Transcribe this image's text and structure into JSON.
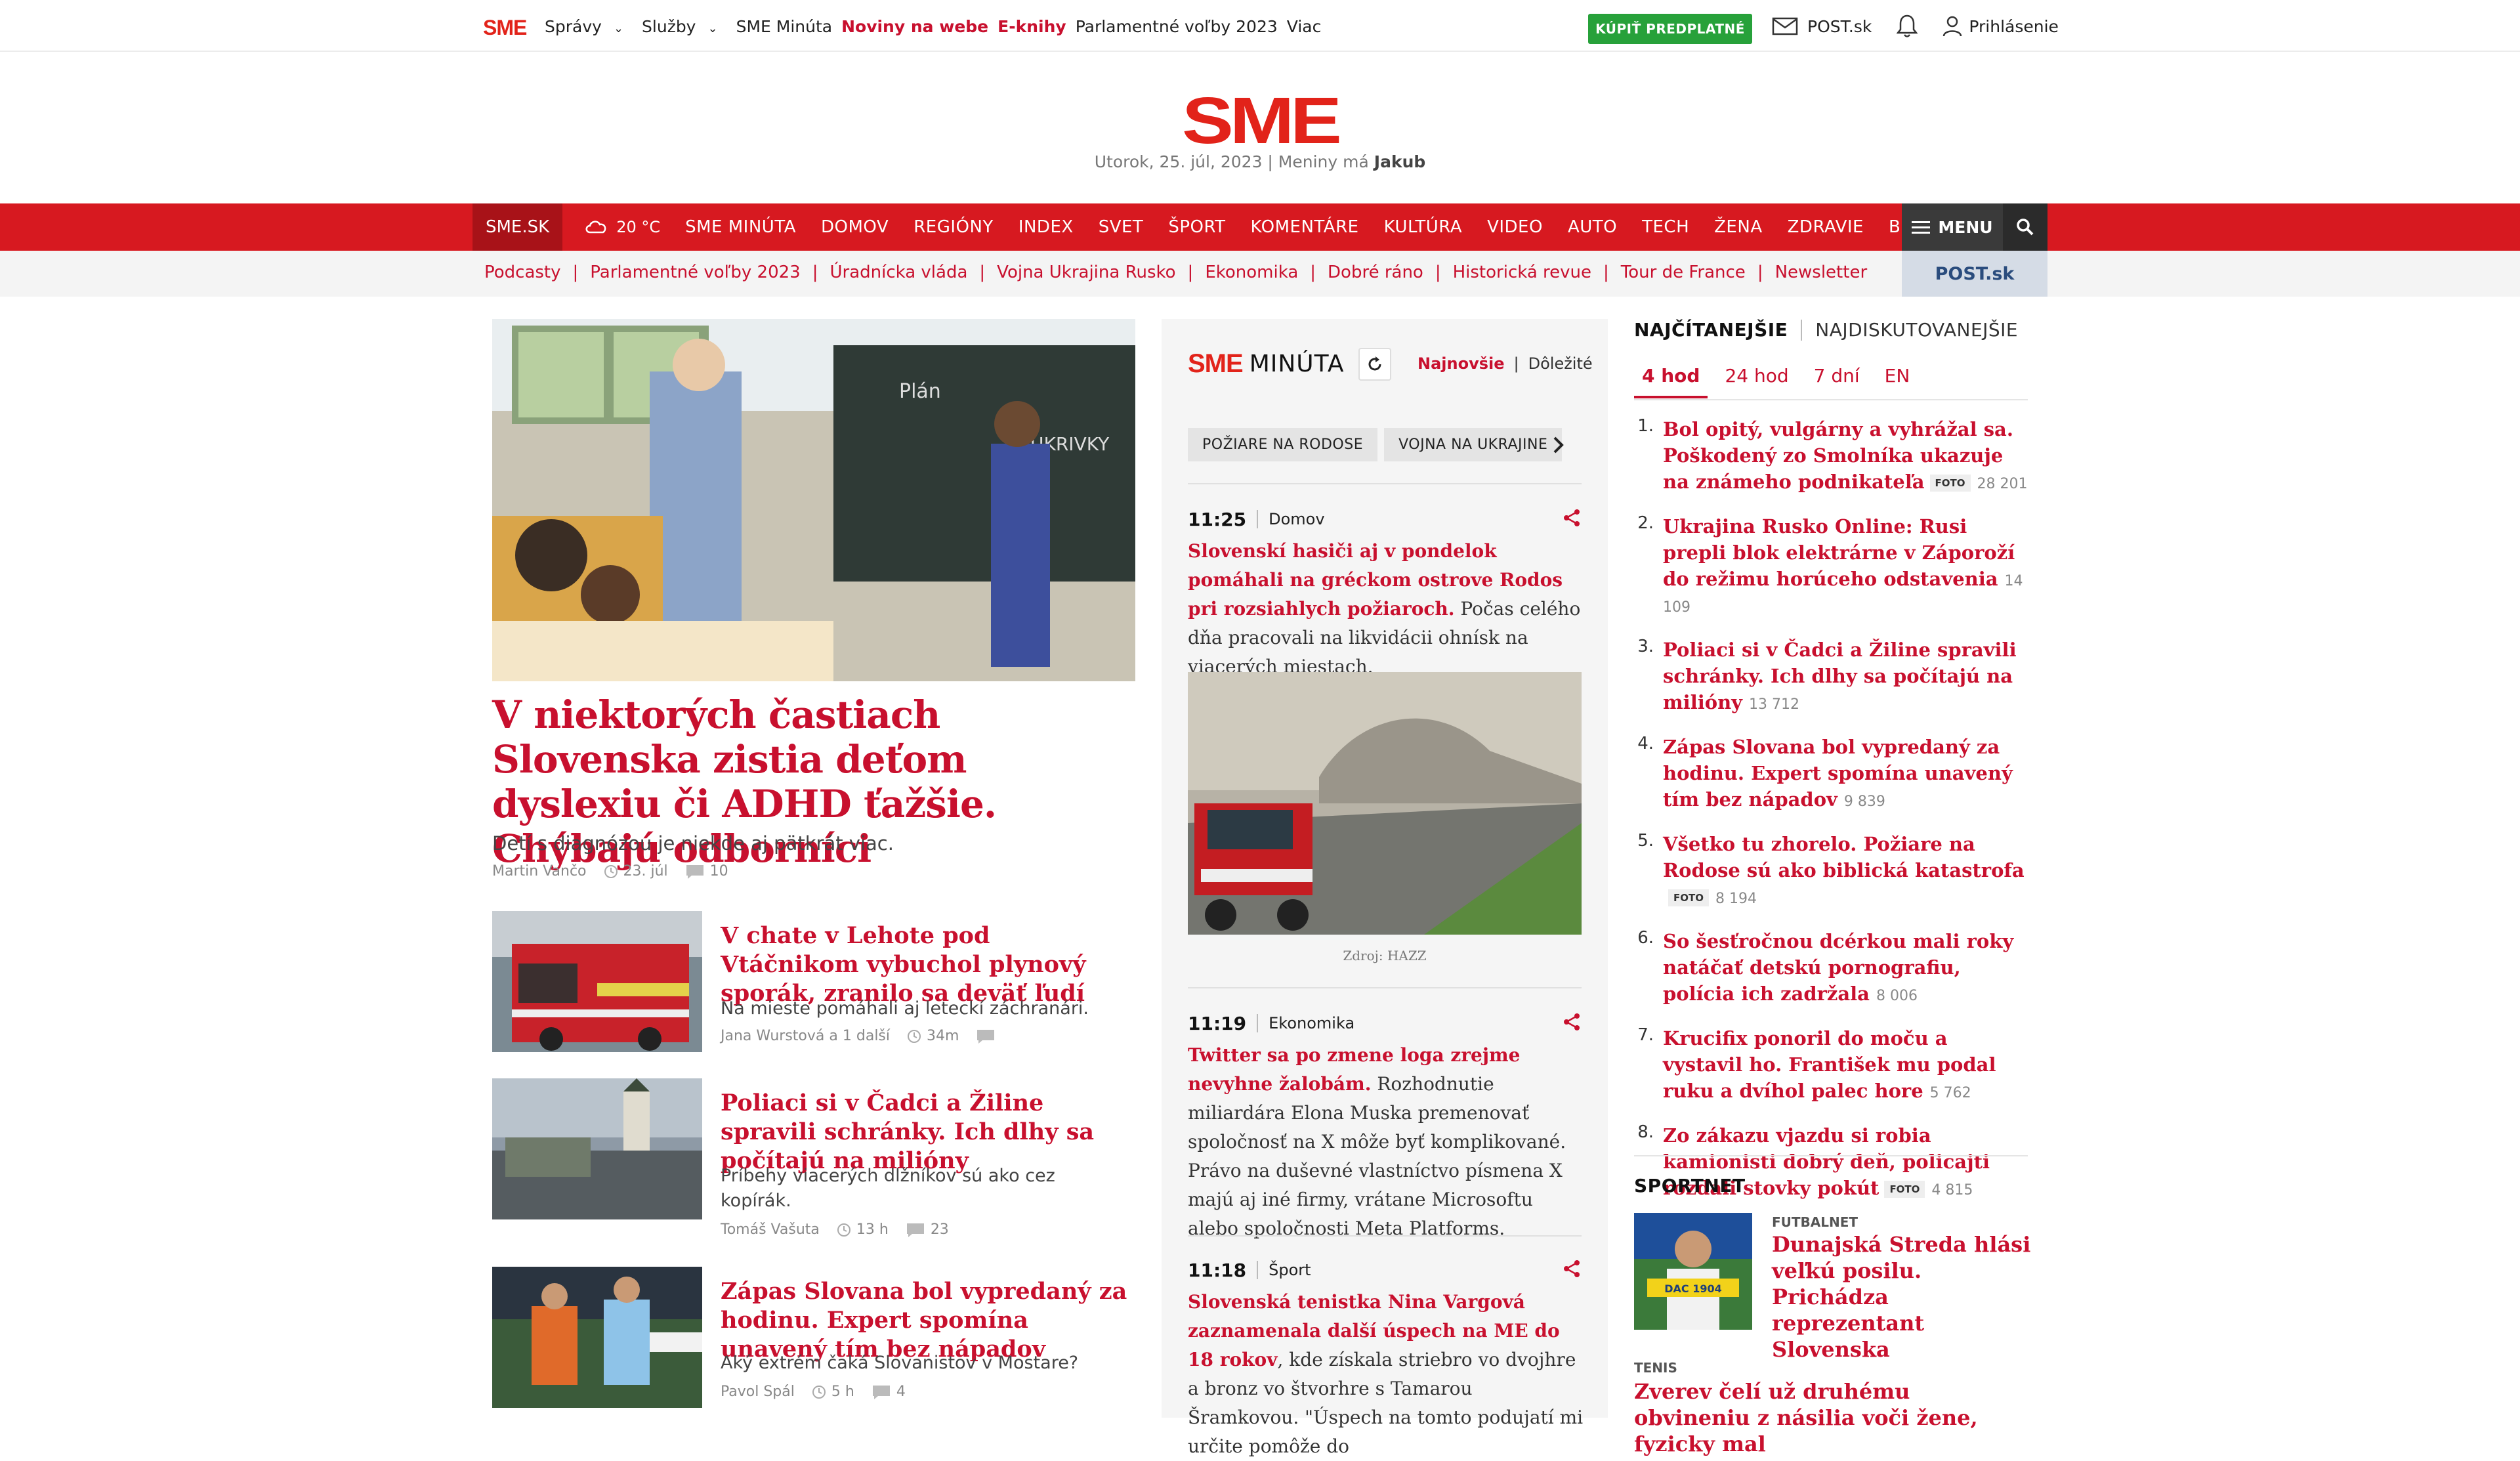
{
  "topbar": {
    "logo": "SME",
    "nav": [
      {
        "label": "Správy",
        "dropdown": true
      },
      {
        "label": "Služby",
        "dropdown": true
      },
      {
        "label": "SME Minúta"
      },
      {
        "label": "Noviny na webe",
        "highlight": true
      },
      {
        "label": "E-knihy",
        "highlight": true
      },
      {
        "label": "Parlamentné voľby 2023"
      },
      {
        "label": "Viac"
      }
    ],
    "subscribe": "KÚPIŤ PREDPLATNÉ",
    "post": "POST.sk",
    "login": "Prihlásenie"
  },
  "masthead": {
    "logo": "SME",
    "date": "Utorok, 25. júl, 2023 | Meniny má",
    "nameday": "Jakub"
  },
  "rednav": {
    "home": "SME.SK",
    "weather": "20 °C",
    "items": [
      "SME MINÚTA",
      "DOMOV",
      "REGIÓNY",
      "INDEX",
      "SVET",
      "ŠPORT",
      "KOMENTÁRE",
      "KULTÚRA",
      "VIDEO",
      "AUTO",
      "TECH",
      "ŽENA",
      "ZDRAVIE",
      "BLOG"
    ],
    "menu": "MENU"
  },
  "subnav": {
    "items": [
      "Podcasty",
      "Parlamentné voľby 2023",
      "Úradnícka vláda",
      "Vojna Ukrajina Rusko",
      "Ekonomika",
      "Dobré ráno",
      "Historická revue",
      "Tour de France",
      "Newsletter"
    ],
    "post": "POST.sk"
  },
  "lead": {
    "title": "V niektorých častiach Slovenska zistia deťom dyslexiu či ADHD ťažšie. Chýbajú odborníci",
    "perex": "Detí s diagnózou je niekde aj pätkrát viac.",
    "author": "Martin Vančo",
    "date": "23. júl",
    "comments": "10"
  },
  "articles": [
    {
      "title": "V chate v Lehote pod Vtáčnikom vybuchol plynový sporák, zranilo sa deväť ľudí",
      "perex": "Na mieste pomáhali aj leteckí záchranári.",
      "author": "Jana Wurstová",
      "extra": "a 1 další",
      "time": "34m",
      "comments": ""
    },
    {
      "title": "Poliaci si v Čadci a Žiline spravili schránky. Ich dlhy sa počítajú na milióny",
      "perex": "Príbehy viacerých dlžníkov sú ako cez kopírák.",
      "author": "Tomáš Vašuta",
      "time": "13 h",
      "comments": "23"
    },
    {
      "title": "Zápas Slovana bol vypredaný za hodinu. Expert spomína unavený tím bez nápadov",
      "perex": "Aký extrém čaká Slovanistov v Mostare?",
      "author": "Pavol Spál",
      "time": "5 h",
      "comments": "4"
    }
  ],
  "minuta": {
    "brand": "SME",
    "title": "MINÚTA",
    "tab_new": "Najnovšie",
    "tab_important": "Dôležité",
    "chips": [
      "POŽIARE NA RODOSE",
      "VOJNA NA UKRAJINE"
    ],
    "items": [
      {
        "time": "11:25",
        "category": "Domov",
        "headline": "Slovenskí hasiči aj v pondelok pomáhali na gréckom ostrove Rodos pri rozsiahlych požiaroch.",
        "text": " Počas celého dňa pracovali na likvidácii ohnísk na viacerých miestach.",
        "caption": "Zdroj: HAZZ"
      },
      {
        "time": "11:19",
        "category": "Ekonomika",
        "headline": "Twitter sa po zmene loga zrejme nevyhne žalobám.",
        "text": " Rozhodnutie miliardára Elona Muska premenovať spoločnosť na X môže byť komplikované. Právo na duševné vlastníctvo písmena X majú aj iné firmy, vrátane Microsoftu alebo spoločnosti Meta Platforms."
      },
      {
        "time": "11:18",
        "category": "Šport",
        "headline": "Slovenská tenistka Nina Vargová zaznamenala další úspech na ME do 18 rokov",
        "text": ", kde získala striebro vo dvojhre a bronz vo štvorhre s Tamarou Šramkovou. \"Úspech na tomto podujatí mi určite pomôže do"
      }
    ]
  },
  "right": {
    "tab_read": "NAJČÍTANEJŠIE",
    "tab_discussed": "NAJDISKUTOVANEJŠIE",
    "periods": [
      "4 hod",
      "24 hod",
      "7 dní",
      "EN"
    ],
    "top": [
      {
        "n": "1.",
        "title": "Bol opitý, vulgárny a vyhrážal sa. Poškodený zo Smolníka ukazuje na známeho podnikateľa",
        "foto": "FOTO",
        "count": "28 201"
      },
      {
        "n": "2.",
        "title": "Ukrajina Rusko Online: Rusi prepli blok elektrárne v Záporoží do režimu horúceho odstavenia",
        "count": "14 109"
      },
      {
        "n": "3.",
        "title": "Poliaci si v Čadci a Žiline spravili schránky. Ich dlhy sa počítajú na milióny",
        "count": "13 712"
      },
      {
        "n": "4.",
        "title": "Zápas Slovana bol vypredaný za hodinu. Expert spomína unavený tím bez nápadov",
        "count": "9 839"
      },
      {
        "n": "5.",
        "title": "Všetko tu zhorelo. Požiare na Rodose sú ako biblická katastrofa",
        "foto": "FOTO",
        "count": "8 194"
      },
      {
        "n": "6.",
        "title": "So šesťročnou dcérkou mali roky natáčať detskú pornografiu, polícia ich zadržala",
        "count": "8 006"
      },
      {
        "n": "7.",
        "title": "Krucifix ponoril do moču a vystavil ho. František mu podal ruku a dvíhol palec hore",
        "count": "5 762"
      },
      {
        "n": "8.",
        "title": "Zo zákazu vjazdu si robia kamionisti dobrý deň, policajti rozdali stovky pokút",
        "foto": "FOTO",
        "count": "4 815"
      }
    ],
    "sport_head": "SPORTNET",
    "sport1_cat": "FUTBALNET",
    "sport1_title": "Dunajská Streda hlási veľkú posilu. Prichádza reprezentant Slovenska",
    "sport2_cat": "TENIS",
    "sport2_title": "Zverev čelí už druhému obvineniu z násilia voči žene, fyzicky mal"
  }
}
